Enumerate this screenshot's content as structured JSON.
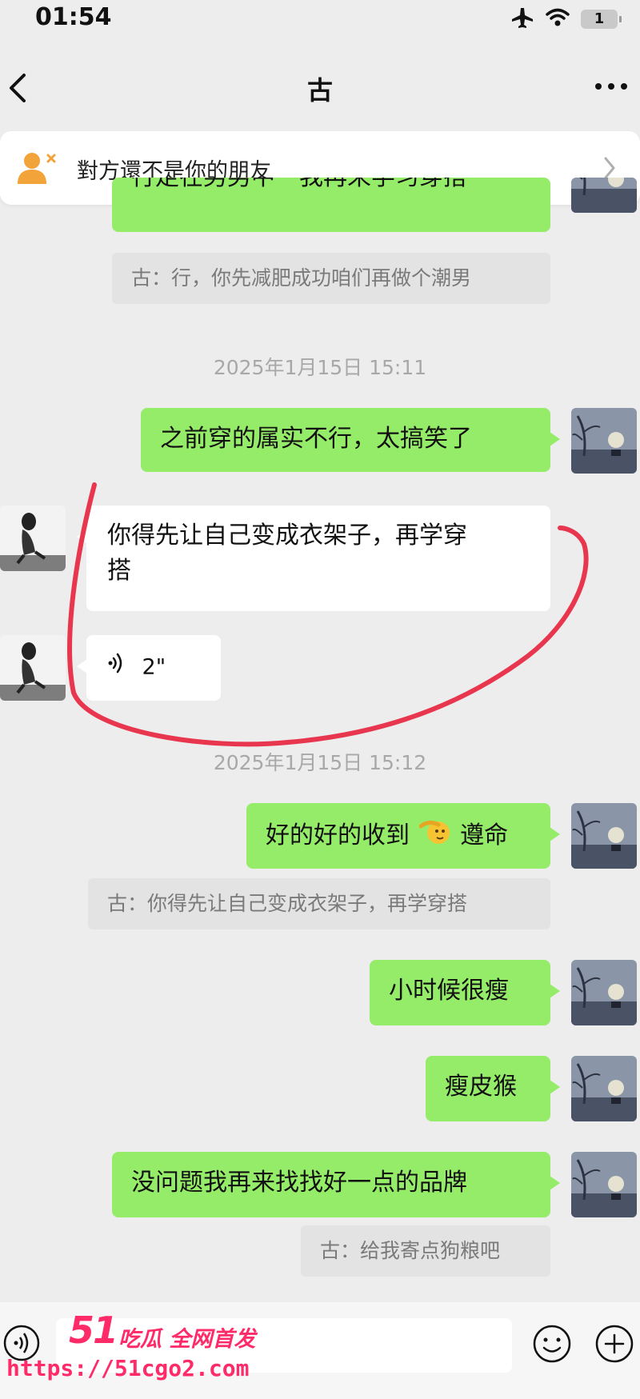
{
  "status_bar": {
    "time": "01:54",
    "battery_level": "1",
    "icons": [
      "airplane-icon",
      "wifi-icon",
      "battery-icon"
    ]
  },
  "nav": {
    "title": "古",
    "icons": [
      "back-chevron-icon",
      "more-dots-icon"
    ]
  },
  "friend_banner": {
    "text": "對方還不是你的朋友",
    "icons": [
      "add-friend-icon",
      "chevron-right-icon"
    ]
  },
  "chat": {
    "top_partial_message": "行走在男男中一我再来学习穿搭",
    "quote_1": "古：行，你先减肥成功咱们再做个潮男",
    "timestamp_1": "2025年1月15日 15:11",
    "msg_out_1": "之前穿的属实不行，太搞笑了",
    "msg_in_1_line1": "你得先让自己变成衣架子，再学穿",
    "msg_in_1_line2": "搭",
    "voice_duration": "2\"",
    "timestamp_2": "2025年1月15日 15:12",
    "msg_out_2_before": "好的好的收到",
    "msg_out_2_after": "遵命",
    "msg_out_2_emoji": "salute-emoji",
    "quote_2": "古：你得先让自己变成衣架子，再学穿搭",
    "msg_out_3": "小时候很瘦",
    "msg_out_4": "瘦皮猴",
    "msg_out_5": "没问题我再来找找好一点的品牌",
    "quote_3": "古：给我寄点狗粮吧"
  },
  "input_bar": {
    "icons": [
      "voice-icon",
      "emoji-icon",
      "plus-icon"
    ]
  },
  "watermark": {
    "logo": "51",
    "title": "吃瓜 全网首发",
    "url": "https://51cgo2.com"
  },
  "colors": {
    "background": "#ededed",
    "outgoing_bubble": "#95ec69",
    "incoming_bubble": "#ffffff",
    "quote_bg": "#e3e3e3",
    "annotation_red": "#e8364e",
    "watermark": "#ff2a68"
  }
}
